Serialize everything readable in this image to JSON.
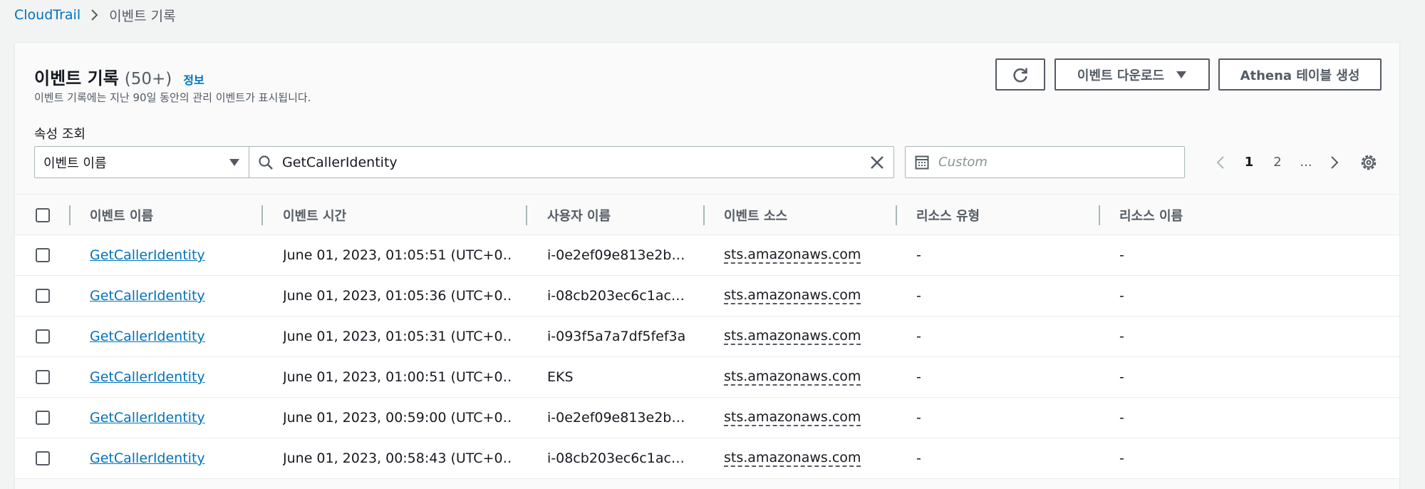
{
  "breadcrumb": {
    "root": "CloudTrail",
    "current": "이벤트 기록"
  },
  "header": {
    "title": "이벤트 기록",
    "count": "(50+)",
    "info": "정보",
    "description": "이벤트 기록에는 지난 90일 동안의 관리 이벤트가 표시됩니다."
  },
  "actions": {
    "refresh_icon": "refresh-icon",
    "download_label": "이벤트 다운로드",
    "athena_label": "Athena 테이블 생성"
  },
  "filter": {
    "lookup_label": "속성 조회",
    "attribute": "이벤트 이름",
    "search_value": "GetCallerIdentity",
    "date_placeholder": "Custom"
  },
  "pagination": {
    "pages": [
      "1",
      "2",
      "..."
    ],
    "current": "1"
  },
  "table": {
    "columns": [
      "이벤트 이름",
      "이벤트 시간",
      "사용자 이름",
      "이벤트 소스",
      "리소스 유형",
      "리소스 이름"
    ],
    "rows": [
      [
        "GetCallerIdentity",
        "June 01, 2023, 01:05:51 (UTC+0…",
        "i-0e2ef09e813e2b…",
        "sts.amazonaws.com",
        "-",
        "-"
      ],
      [
        "GetCallerIdentity",
        "June 01, 2023, 01:05:36 (UTC+0…",
        "i-08cb203ec6c1ac…",
        "sts.amazonaws.com",
        "-",
        "-"
      ],
      [
        "GetCallerIdentity",
        "June 01, 2023, 01:05:31 (UTC+0…",
        "i-093f5a7a7df5fef3a",
        "sts.amazonaws.com",
        "-",
        "-"
      ],
      [
        "GetCallerIdentity",
        "June 01, 2023, 01:00:51 (UTC+0…",
        "EKS",
        "sts.amazonaws.com",
        "-",
        "-"
      ],
      [
        "GetCallerIdentity",
        "June 01, 2023, 00:59:00 (UTC+0…",
        "i-0e2ef09e813e2b…",
        "sts.amazonaws.com",
        "-",
        "-"
      ],
      [
        "GetCallerIdentity",
        "June 01, 2023, 00:58:43 (UTC+0…",
        "i-08cb203ec6c1ac…",
        "sts.amazonaws.com",
        "-",
        "-"
      ]
    ]
  },
  "colors": {
    "link": "#0073bb",
    "text": "#16191f",
    "muted": "#545b64",
    "background": "#f2f3f3"
  }
}
